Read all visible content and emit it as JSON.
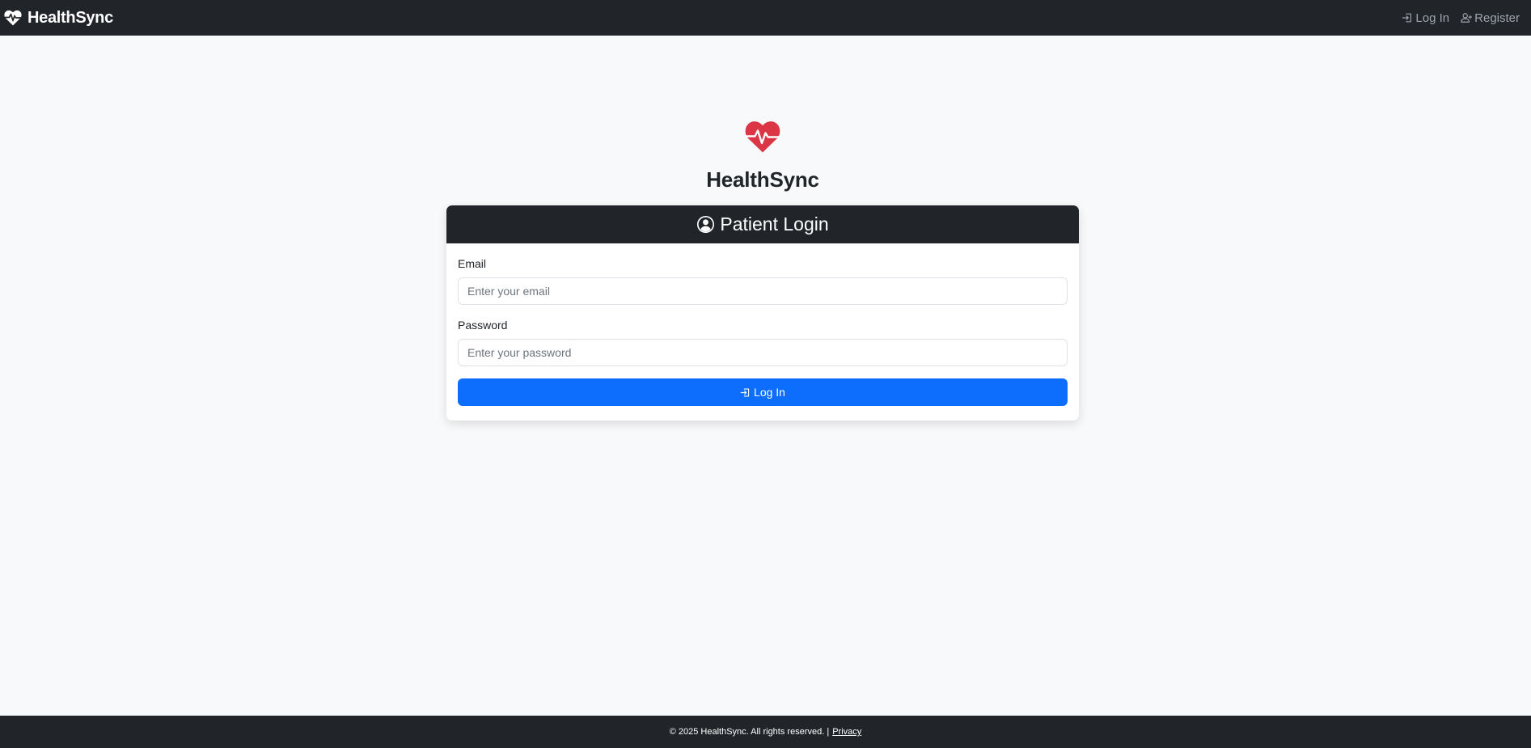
{
  "navbar": {
    "brand": "HealthSync",
    "brand_icon": "heart-pulse-icon",
    "links": [
      {
        "label": "Log In",
        "icon": "login-icon"
      },
      {
        "label": "Register",
        "icon": "add-user-icon"
      }
    ]
  },
  "main": {
    "logo_icon": "heart-pulse-icon",
    "title": "HealthSync"
  },
  "login_card": {
    "header": "Patient Login",
    "header_icon": "user-circle-icon",
    "email_label": "Email",
    "email_placeholder": "Enter your email",
    "email_value": "",
    "password_label": "Password",
    "password_placeholder": "Enter your password",
    "password_value": "",
    "submit_label": "Log In",
    "submit_icon": "login-icon"
  },
  "footer": {
    "copyright": "© 2025 HealthSync. All rights reserved. |",
    "privacy": "Privacy"
  },
  "colors": {
    "navbar_bg": "#212529",
    "page_bg": "#f8f9fa",
    "brand_heart": "#dc3545",
    "primary": "#0d6efd",
    "nav_link": "#9ea4ab"
  }
}
